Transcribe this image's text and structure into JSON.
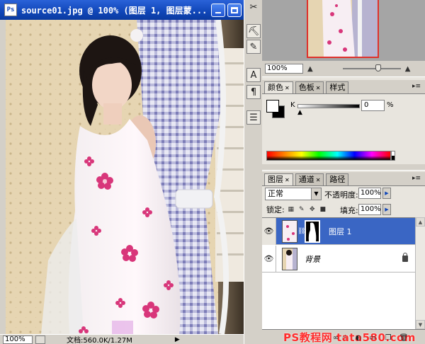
{
  "document": {
    "title": "source01.jpg @ 100% (图层 1, 图层蒙...",
    "zoom": "100%",
    "doc_info": "文档:560.0K/1.27M",
    "status_arrow": "▶"
  },
  "toolbox": {
    "icons": [
      "scissors-icon",
      "stamp-icon",
      "history-brush-icon",
      "type-icon",
      "paragraph-icon",
      "notes-icon"
    ]
  },
  "navigator": {
    "zoom": "100%"
  },
  "color_panel": {
    "tabs": [
      {
        "label": "颜色"
      },
      {
        "label": "色板"
      },
      {
        "label": "样式"
      }
    ],
    "channel_label": "K",
    "value": "0",
    "unit": "%"
  },
  "layers_panel": {
    "tabs": [
      {
        "label": "图层"
      },
      {
        "label": "通道"
      },
      {
        "label": "路径"
      }
    ],
    "blend_mode": "正常",
    "opacity_label": "不透明度:",
    "opacity_value": "100%",
    "lock_label": "锁定:",
    "fill_label": "填充:",
    "fill_value": "100%",
    "layers": [
      {
        "name": "图层 1",
        "selected": true,
        "has_mask": true
      },
      {
        "name": "背景",
        "selected": false,
        "locked": true
      }
    ]
  },
  "watermark": {
    "text": "PS教程网 tata580.com"
  },
  "colors": {
    "title_bar": "#1046b8",
    "selected_layer": "#3a66c4",
    "nav_frame": "#e0302a",
    "watermark": "#ff2c2c"
  }
}
